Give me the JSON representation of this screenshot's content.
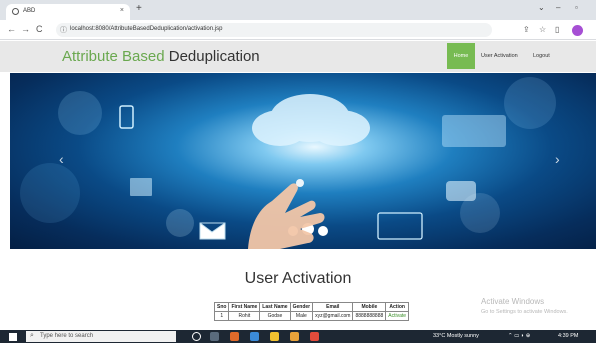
{
  "browser": {
    "tab_title": "ABD",
    "tab_close": "×",
    "new_tab": "+",
    "url": "localhost:8080/AttributeBasedDeduplication/activation.jsp",
    "back": "←",
    "forward": "→",
    "reload": "C"
  },
  "header": {
    "brand_part1": "Attribute Based",
    "brand_part2": "Deduplication",
    "nav": [
      "Home",
      "User Activation",
      "Logout"
    ]
  },
  "hero": {
    "prev": "‹",
    "next": "›"
  },
  "main": {
    "title": "User Activation",
    "table": {
      "headers": [
        "Sno",
        "First Name",
        "Last Name",
        "Gender",
        "Email",
        "Mobile",
        "Action"
      ],
      "rows": [
        [
          "1",
          "Rohit",
          "Godse",
          "Male",
          "xyz@gmail.com",
          "8888888888",
          "Activate"
        ]
      ]
    }
  },
  "watermark": {
    "title": "Activate Windows",
    "subtitle": "Go to Settings to activate Windows."
  },
  "taskbar": {
    "search_placeholder": "Type here to search",
    "weather": "33°C  Mostly sunny",
    "time": "4:39 PM"
  }
}
